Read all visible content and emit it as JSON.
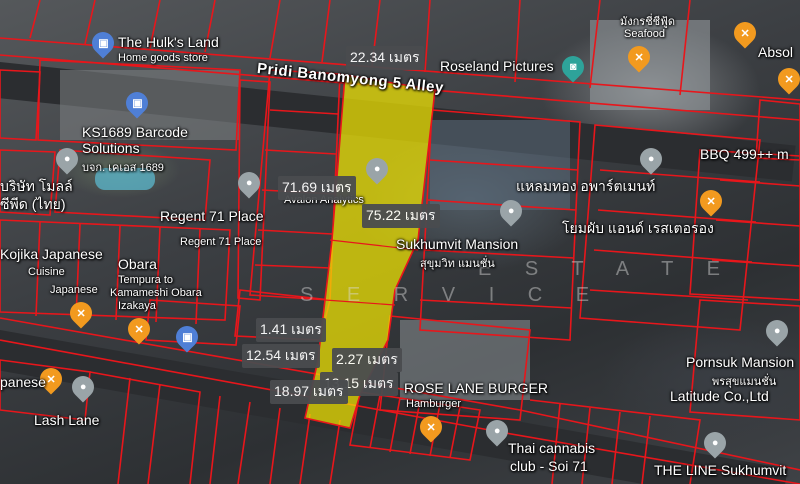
{
  "map": {
    "places": {
      "hulks_land": "The Hulk's Land",
      "hulks_land_sub": "Home goods store",
      "pridi_alley": "Pridi Banomyong 5 Alley",
      "roseland": "Roseland Pictures",
      "seafood": "Seafood",
      "seafood_thai": "มังกรชี่ชีฟู้ด",
      "absol": "Absol",
      "ks1689": "KS1689 Barcode",
      "ks1689_l2": "Solutions",
      "ks1689_l3": "บจก. เคเอส 1689",
      "bbq": "BBQ 499++ m",
      "thai_left": "บริษัท โมลล์",
      "thai_left2": "ซีพีด (ไทย)",
      "avalon": "Avalon Analytics",
      "flame": "แหลมทอง อพาร์ตเมนท์",
      "regent": "Regent 71 Place",
      "regent2": "Regent 71 Place",
      "sukhumvit_mansion": "Sukhumvit Mansion",
      "sukhumvit_mansion_th": "สุขุมวิท แมนชั่น",
      "yellow_rest": "โยมผับ แอนด์ เรสเตอรอง",
      "kojika": "Kojika Japanese",
      "kojika2": "Cuisine",
      "obara": "Obara",
      "tempura": "Tempura to",
      "kamameshi": "Kamameshi Obara",
      "izakaya": "Izakaya",
      "japanese": "Japanese",
      "pornsuk": "Pornsuk Mansion",
      "pornsuk_th": "พรสุขแมนชั่น",
      "rose_lane": "ROSE LANE BURGER",
      "hamburger": "Hamburger",
      "latitude": "Latitude Co.,Ltd",
      "lash_lane": "Lash Lane",
      "thai_cannabis": "Thai cannabis",
      "thai_cannabis2": "club - Soi 71",
      "the_line": "THE LINE Sukhumvit",
      "panese": "panese"
    },
    "measurements": {
      "m1": "22.34 เมตร",
      "m2": "71.69 เมตร",
      "m3": "75.22 เมตร",
      "m4": "1.41 เมตร",
      "m5": "12.54 เมตร",
      "m6": "2.27 เมตร",
      "m7": "13.15 เมตร",
      "m8": "18.97 เมตร"
    },
    "watermark": {
      "line1": "E S T A T E",
      "line2": "S E R V I C E"
    },
    "colors": {
      "parcel_outline": "#e8161b",
      "highlight_fill": "#f2e600",
      "pin_orange": "#f29a1f",
      "pin_blue": "#4f7fd6"
    },
    "icons": {
      "shop": "shopping-bag-icon",
      "food": "restaurant-icon",
      "place": "place-icon",
      "camera": "camera-icon"
    }
  }
}
